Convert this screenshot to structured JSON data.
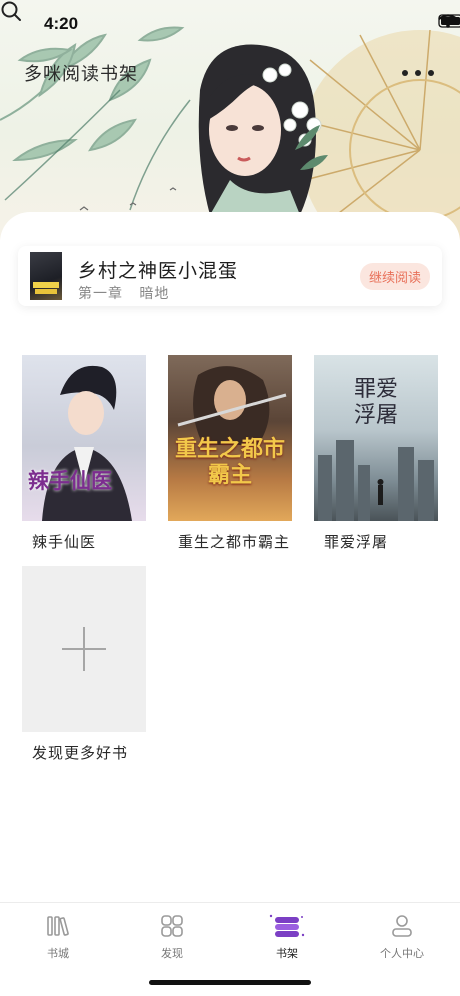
{
  "status_bar": {
    "time": "4:20"
  },
  "header": {
    "title": "多咪阅读书架"
  },
  "recent": {
    "title": "乡村之神医小混蛋",
    "chapter": "第一章   暗地",
    "continue_label": "继续阅读"
  },
  "books": [
    {
      "title": "辣手仙医",
      "cover_text": "辣手仙医"
    },
    {
      "title": "重生之都市霸主",
      "cover_text": "重生之都市霸主"
    },
    {
      "title": "罪爱浮屠",
      "cover_text": "罪爱浮屠"
    }
  ],
  "discover_more": {
    "label": "发现更多好书"
  },
  "tabs": [
    {
      "label": "书城",
      "icon": "bookstore-icon"
    },
    {
      "label": "发现",
      "icon": "discover-grid-icon"
    },
    {
      "label": "书架",
      "icon": "bookshelf-icon",
      "active": true
    },
    {
      "label": "个人中心",
      "icon": "profile-icon"
    }
  ],
  "colors": {
    "accent": "#e8715a",
    "accent_bg": "#fbe6df",
    "active_tab": "#7b3fc4"
  }
}
